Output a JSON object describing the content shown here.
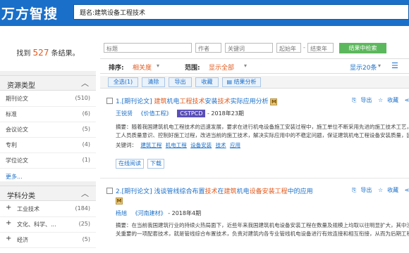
{
  "header": {
    "logo": "万方智搜",
    "search_value": "题名:建筑设备工程技术"
  },
  "summary": {
    "prefix": "找到",
    "count": "527",
    "suffix": "条结果。"
  },
  "sidebar": {
    "section1": {
      "title": "资源类型",
      "collapse_icon": "chevron-up",
      "more": "更多..."
    },
    "resource_types": [
      {
        "label": "期刊论文",
        "count": "(510)"
      },
      {
        "label": "标准",
        "count": "(6)"
      },
      {
        "label": "会议论文",
        "count": "(5)"
      },
      {
        "label": "专利",
        "count": "(4)"
      },
      {
        "label": "学位论文",
        "count": "(1)"
      }
    ],
    "section2": {
      "title": "学科分类",
      "collapse_icon": "chevron-up"
    },
    "subjects": [
      {
        "label": "工业技术",
        "count": "(184)"
      },
      {
        "label": "文化、科学、...",
        "count": "(25)"
      },
      {
        "label": "经济",
        "count": "(5)"
      }
    ]
  },
  "advanced": {
    "title_ph": "标题",
    "author_ph": "作者",
    "keyword_ph": "关键词",
    "year_start_ph": "起始年",
    "dash": "-",
    "year_end_ph": "结束年",
    "button": "结果中检索"
  },
  "sortbar": {
    "sort_label": "排序:",
    "sort_value": "相关度",
    "range_label": "范围:",
    "range_value": "显示全部",
    "page_size": "显示20条"
  },
  "toolbar": {
    "select_all": "全选(1)",
    "clear": "清除",
    "export": "导出",
    "favorite": "收藏",
    "analysis": "结果分析"
  },
  "results": [
    {
      "index": "1.[期刊论文]",
      "title_parts": [
        "建筑",
        "机电",
        "工程技术",
        "安装",
        "技术",
        "实际应用分析"
      ],
      "m_icon": "M",
      "author": "王锐贤",
      "journal": "《价值工程》",
      "badge": "CSTPCD",
      "year": "- 2018年23期",
      "abstract_line1": "摘要：随着我国建筑机电工程技术的迅速发展，要求在进行机电设备施工安装过程中，施工单位不断采用先进的施工技术工艺，操作",
      "abstract_line2": "工人员质量意识、控制好施工过程，改进当前的施工技术，解决实际应用中的不稳定问题，保证建筑机电工程设备安装质量，因此，本",
      "keywords_label": "关键词：",
      "keywords": [
        "建筑工程",
        "机电工程",
        "设备安装",
        "技术",
        "应用"
      ],
      "read": "在线阅读",
      "download": "下载",
      "actions": {
        "export": "导出",
        "favorite": "收藏"
      }
    },
    {
      "index": "2.[期刊论文]",
      "title_parts": [
        "浅谈管线综合布置",
        "技术",
        "在",
        "建筑",
        "机电",
        "设备",
        "安装",
        "工程",
        "中的应用"
      ],
      "m_icon": "M",
      "author": "杨旭",
      "journal": "《河南建材》",
      "year": "- 2018年4期",
      "abstract_line1": "摘要：在当前我国建筑行业的持续火热局面下，近些年来我国建筑机电设备安装工程在数量及规模上均取以往明显扩大，其中涉及",
      "abstract_line2": "关重要的一项配套技术，就是管线综合布置技术，负责对建筑内各专业管线机电设备进行有效连接和相互衔接，从而为后期工程",
      "actions": {
        "export": "导出",
        "favorite": "收藏"
      }
    }
  ],
  "colors": {
    "header_blue": "#1a6fc9",
    "accent_orange": "#e05a1e",
    "green": "#5cb85c",
    "badge_purple": "#5a4fb8"
  }
}
